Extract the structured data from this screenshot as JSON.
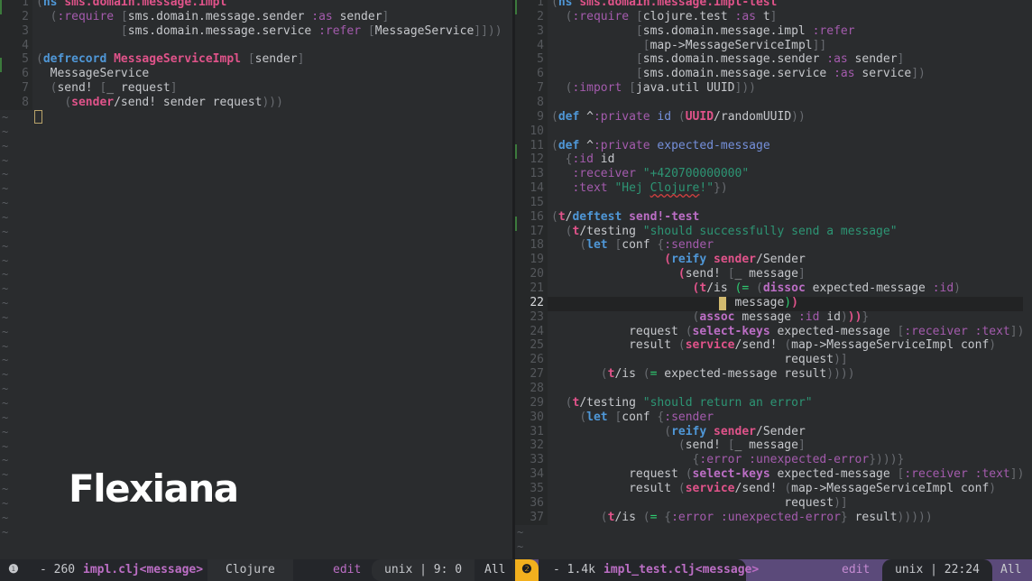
{
  "left_pane": {
    "lines": [
      {
        "n": "1",
        "html": "<span class='br'>(</span><span class='kw'>ns</span> <span class='ns'>sms.domain.message.impl</span>"
      },
      {
        "n": "2",
        "html": "  <span class='br'>(</span><span class='kwd'>:require</span> <span class='br'>[</span>sms.domain.message.sender <span class='kwd'>:as</span> sender<span class='br'>]</span>"
      },
      {
        "n": "3",
        "html": "            <span class='br'>[</span>sms.domain.message.service <span class='kwd'>:refer</span> <span class='br'>[</span>MessageService<span class='br'>]]))</span>"
      },
      {
        "n": "4",
        "html": ""
      },
      {
        "n": "5",
        "html": "<span class='br'>(</span><span class='kw'>defrecord</span> <span class='ns'>MessageServiceImpl</span> <span class='br'>[</span>sender<span class='br'>]</span>"
      },
      {
        "n": "6",
        "html": "  MessageService"
      },
      {
        "n": "7",
        "html": "  <span class='br'>(</span>send! <span class='br'>[</span>_ request<span class='br'>]</span>"
      },
      {
        "n": "8",
        "html": "    <span class='br'>(</span><span class='ns'>sender</span>/send! sender request<span class='br'>)))</span>"
      }
    ],
    "tilde_count": 30
  },
  "right_pane": {
    "current_line": "22",
    "lines": [
      {
        "n": "1",
        "html": "<span class='br'>(</span><span class='kw'>ns</span> <span class='ns'>sms.domain.message.impl-test</span>"
      },
      {
        "n": "2",
        "html": "  <span class='br'>(</span><span class='kwd'>:require</span> <span class='br'>[</span>clojure.test <span class='kwd'>:as</span> t<span class='br'>]</span>"
      },
      {
        "n": "3",
        "html": "            <span class='br'>[</span>sms.domain.message.impl <span class='kwd'>:refer</span>"
      },
      {
        "n": "4",
        "html": "             <span class='br'>[</span>map-&gt;MessageServiceImpl<span class='br'>]]</span>"
      },
      {
        "n": "5",
        "html": "            <span class='br'>[</span>sms.domain.message.sender <span class='kwd'>:as</span> sender<span class='br'>]</span>"
      },
      {
        "n": "6",
        "html": "            <span class='br'>[</span>sms.domain.message.service <span class='kwd'>:as</span> service<span class='br'>])</span>"
      },
      {
        "n": "7",
        "html": "  <span class='br'>(</span><span class='kwd'>:import</span> <span class='br'>[</span>java.util UUID<span class='br'>]))</span>"
      },
      {
        "n": "8",
        "html": ""
      },
      {
        "n": "9",
        "html": "<span class='br'>(</span><span class='kw'>def</span> ^<span class='kwd'>:private</span> <span class='def'>id</span> <span class='br'>(</span><span class='ns'>UUID</span>/randomUUID<span class='br'>))</span>"
      },
      {
        "n": "10",
        "html": ""
      },
      {
        "n": "11",
        "html": "<span class='br'>(</span><span class='kw'>def</span> ^<span class='kwd'>:private</span> <span class='def'>expected-message</span>"
      },
      {
        "n": "12",
        "html": "  <span class='br'>{</span><span class='kwd'>:id</span> id"
      },
      {
        "n": "13",
        "html": "   <span class='kwd'>:receiver</span> <span class='str'>\"+420700000000\"</span>"
      },
      {
        "n": "14",
        "html": "   <span class='kwd'>:text</span> <span class='str'>\"Hej <span class='spell'>Clojure</span>!\"</span><span class='br'>})</span>"
      },
      {
        "n": "15",
        "html": ""
      },
      {
        "n": "16",
        "html": "<span class='br'>(</span><span class='ns'>t</span>/<span class='kw'>deftest</span> <span class='fn'>send!-test</span>"
      },
      {
        "n": "17",
        "html": "  <span class='br'>(</span><span class='ns'>t</span>/testing <span class='str'>\"should successfully send a message\"</span>"
      },
      {
        "n": "18",
        "html": "    <span class='br'>(</span><span class='kw'>let</span> <span class='br'>[</span>conf <span class='br'>{</span><span class='kwd'>:sender</span>"
      },
      {
        "n": "19",
        "html": "                <span class='ns'>(</span><span class='kw'>reify</span> <span class='ns'>sender</span>/Sender"
      },
      {
        "n": "20",
        "html": "                  <span class='ns'>(</span>send! <span class='br'>[</span>_ message<span class='br'>]</span>"
      },
      {
        "n": "21",
        "html": "                    <span class='ns'>(t</span>/is <span class='eq'>(=</span> <span class='br'>(</span><span class='fn'>dissoc</span> expected-message <span class='kwd'>:id</span><span class='br'>)</span>"
      },
      {
        "n": "22",
        "html": "                          message<span class='eq'>)</span><span class='ns'>)</span>"
      },
      {
        "n": "23",
        "html": "                    <span class='br'>(</span><span class='fn'>assoc</span> message <span class='kwd'>:id</span> id<span class='br'>)</span><span class='ns'>))</span><span class='br'>}</span>"
      },
      {
        "n": "24",
        "html": "           request <span class='br'>(</span><span class='fn'>select-keys</span> expected-message <span class='br'>[</span><span class='kwd'>:receiver :text</span><span class='br'>])</span>"
      },
      {
        "n": "25",
        "html": "           result <span class='br'>(</span><span class='ns'>service</span>/send! <span class='br'>(</span>map-&gt;MessageServiceImpl conf<span class='br'>)</span>"
      },
      {
        "n": "26",
        "html": "                                 request<span class='br'>)]</span>"
      },
      {
        "n": "27",
        "html": "       <span class='br'>(</span><span class='ns'>t</span>/is <span class='br'>(</span><span class='eq'>=</span> expected-message result<span class='br'>))))</span>"
      },
      {
        "n": "28",
        "html": ""
      },
      {
        "n": "29",
        "html": "  <span class='br'>(</span><span class='ns'>t</span>/testing <span class='str'>\"should return an error\"</span>"
      },
      {
        "n": "30",
        "html": "    <span class='br'>(</span><span class='kw'>let</span> <span class='br'>[</span>conf <span class='br'>{</span><span class='kwd'>:sender</span>"
      },
      {
        "n": "31",
        "html": "                <span class='br'>(</span><span class='kw'>reify</span> <span class='ns'>sender</span>/Sender"
      },
      {
        "n": "32",
        "html": "                  <span class='br'>(</span>send! <span class='br'>[</span>_ message<span class='br'>]</span>"
      },
      {
        "n": "33",
        "html": "                    <span class='br'>{</span><span class='kwd'>:error :unexpected-error</span><span class='br'>})))}</span>"
      },
      {
        "n": "34",
        "html": "           request <span class='br'>(</span><span class='fn'>select-keys</span> expected-message <span class='br'>[</span><span class='kwd'>:receiver :text</span><span class='br'>])</span>"
      },
      {
        "n": "35",
        "html": "           result <span class='br'>(</span><span class='ns'>service</span>/send! <span class='br'>(</span>map-&gt;MessageServiceImpl conf<span class='br'>)</span>"
      },
      {
        "n": "36",
        "html": "                                 request<span class='br'>)]</span>"
      },
      {
        "n": "37",
        "html": "       <span class='br'>(</span><span class='ns'>t</span>/is <span class='br'>(</span><span class='eq'>=</span> <span class='br'>{</span><span class='kwd'>:error :unexpected-error</span><span class='br'>}</span> result<span class='br'>)))))</span>"
      }
    ],
    "tilde_count": 2
  },
  "logo": {
    "text": "Flexiana"
  },
  "status_left": {
    "window_number": "❶",
    "size": "- 260",
    "buffer_name": "impl.clj<message>",
    "major_mode": "Clojure",
    "state": "edit",
    "encoding": "unix",
    "separator": "|",
    "position": "9: 0",
    "scroll": "All"
  },
  "status_right": {
    "window_number": "❷",
    "size": "- 1.4k",
    "buffer_name": "impl_test.clj<message>",
    "state": "edit",
    "encoding": "unix",
    "separator": "|",
    "position": "22:24",
    "scroll": "All",
    "accent_color": "#f2b01e",
    "bar_color": "#5b4a7a"
  }
}
